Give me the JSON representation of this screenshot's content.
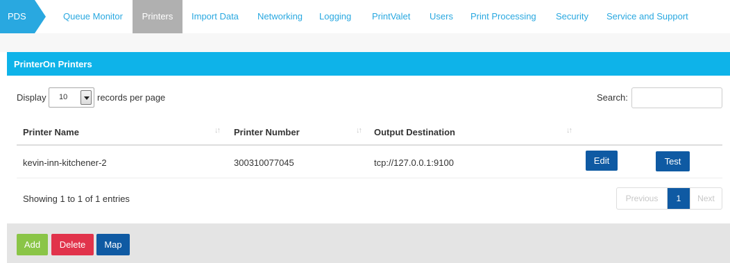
{
  "nav": {
    "brand": "PDS",
    "items": [
      "Queue Monitor",
      "Printers",
      "Import Data",
      "Networking",
      "Logging",
      "PrintValet",
      "Users",
      "Print Processing",
      "Security",
      "Service and Support"
    ],
    "active": "Printers"
  },
  "panel": {
    "title": "PrinterOn Printers"
  },
  "controls": {
    "display_label": "Display",
    "records_value": "10",
    "records_label": "records per page",
    "search_label": "Search:",
    "search_value": ""
  },
  "table": {
    "headers": [
      "Printer Name",
      "Printer Number",
      "Output Destination"
    ],
    "rows": [
      {
        "name": "kevin-inn-kitchener-2",
        "number": "300310077045",
        "destination": "tcp://127.0.0.1:9100",
        "edit_label": "Edit",
        "test_label": "Test"
      }
    ]
  },
  "footer": {
    "info": "Showing 1 to 1 of 1 entries",
    "pagination": {
      "previous": "Previous",
      "current": "1",
      "next": "Next"
    }
  },
  "actions": {
    "add": "Add",
    "delete": "Delete",
    "map": "Map"
  },
  "colors": {
    "brand_blue": "#29a8e0",
    "panel_header": "#0eb3e9",
    "primary_button": "#0f5aa3",
    "add_button": "#8ac547",
    "delete_button": "#e1334b",
    "active_tab": "#b0b0b0"
  }
}
